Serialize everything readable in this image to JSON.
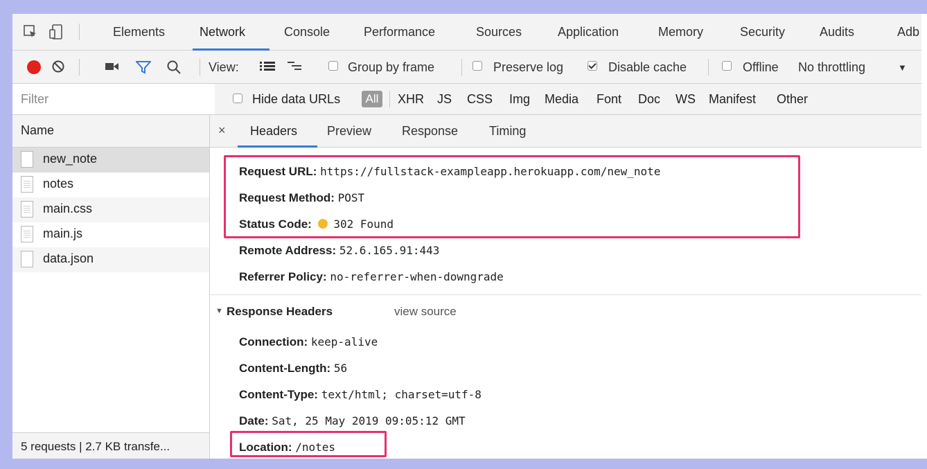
{
  "main_tabs": [
    "Elements",
    "Network",
    "Console",
    "Performance",
    "Sources",
    "Application",
    "Memory",
    "Security",
    "Audits",
    "Adb"
  ],
  "active_tab": "Network",
  "toolbar": {
    "view_label": "View:",
    "group_by_frame": "Group by frame",
    "preserve_log": "Preserve log",
    "disable_cache": "Disable cache",
    "offline": "Offline",
    "throttling": "No throttling",
    "record_color": "#e3201b"
  },
  "filter": {
    "placeholder": "Filter",
    "hide_data_urls": "Hide data URLs",
    "types": [
      "All",
      "XHR",
      "JS",
      "CSS",
      "Img",
      "Media",
      "Font",
      "Doc",
      "WS",
      "Manifest",
      "Other"
    ]
  },
  "requests": {
    "header": "Name",
    "items": [
      "new_note",
      "notes",
      "main.css",
      "main.js",
      "data.json"
    ],
    "summary": "5 requests | 2.7 KB transfe..."
  },
  "detail": {
    "close": "×",
    "tabs": [
      "Headers",
      "Preview",
      "Response",
      "Timing"
    ],
    "active_tab": "Headers",
    "general": {
      "request_url_label": "Request URL:",
      "request_url": "https://fullstack-exampleapp.herokuapp.com/new_note",
      "request_method_label": "Request Method:",
      "request_method": "POST",
      "status_code_label": "Status Code:",
      "status_code": "302 Found",
      "remote_address_label": "Remote Address:",
      "remote_address": "52.6.165.91:443",
      "referrer_policy_label": "Referrer Policy:",
      "referrer_policy": "no-referrer-when-downgrade"
    },
    "response_headers": {
      "title": "Response Headers",
      "view_source": "view source",
      "connection_label": "Connection:",
      "connection": "keep-alive",
      "content_length_label": "Content-Length:",
      "content_length": "56",
      "content_type_label": "Content-Type:",
      "content_type": "text/html; charset=utf-8",
      "date_label": "Date:",
      "date": "Sat, 25 May 2019 09:05:12 GMT",
      "location_label": "Location:",
      "location": "/notes"
    }
  },
  "colors": {
    "highlight": "#e8306a",
    "status_dot": "#f5b82e",
    "accent": "#3879d9"
  }
}
